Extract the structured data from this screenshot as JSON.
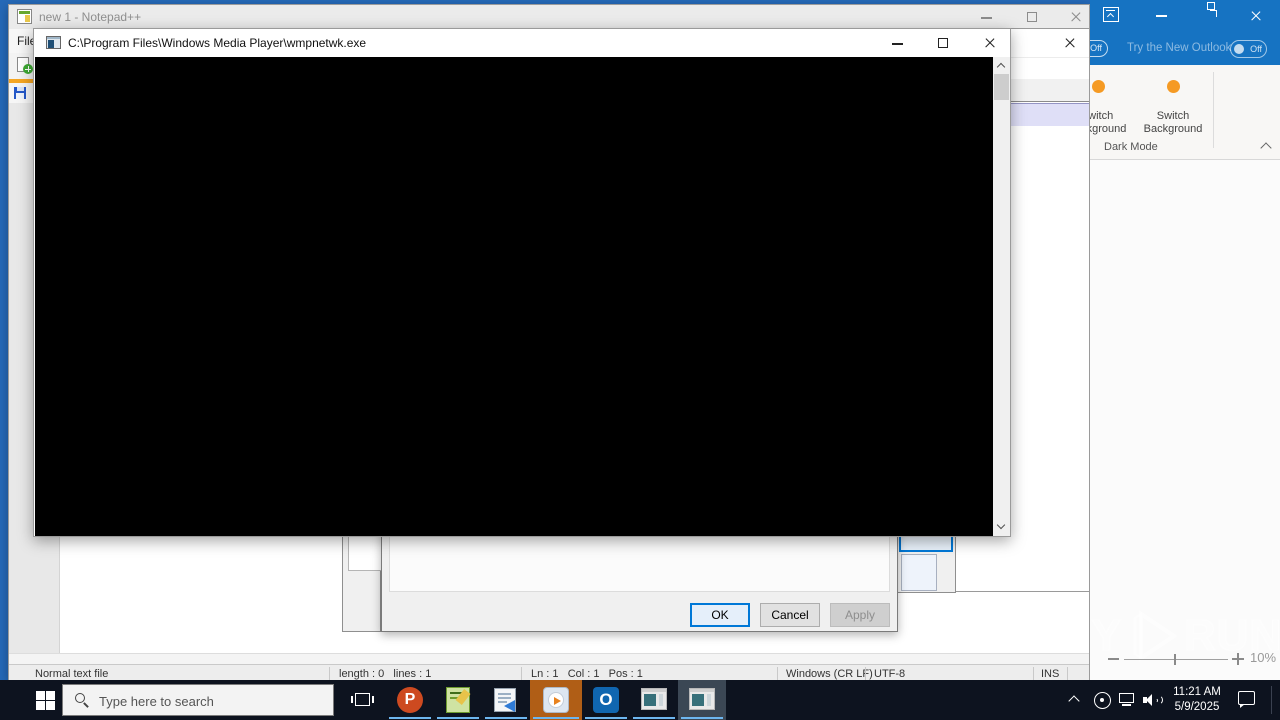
{
  "notepad": {
    "title": "new 1 - Notepad++",
    "menu": {
      "file": "File"
    },
    "statusbar": {
      "doc_type": "Normal text file",
      "length_info": "length : 0   lines : 1",
      "cursor_info": "Ln : 1   Col : 1   Pos : 1",
      "eol_format": "Windows (CR LF)",
      "encoding": "UTF-8",
      "typing_mode": "INS"
    }
  },
  "console": {
    "title": "C:\\Program Files\\Windows Media Player\\wmpnetwk.exe"
  },
  "dialog": {
    "ok_label": "OK",
    "cancel_label": "Cancel",
    "apply_label": "Apply"
  },
  "outlook": {
    "try_new_label": "Try the New Outlook",
    "toggle_state": "Off",
    "partial_toggle_state": "Off",
    "switch_background_1": "Switch Background",
    "switch_background_2": "Switch Background",
    "group_label": "Dark Mode"
  },
  "taskbar": {
    "search_placeholder": "Type here to search",
    "clock_time": "11:21 AM",
    "clock_date": "5/9/2025",
    "app_glyphs": {
      "powerpoint": "P",
      "outlook": "O"
    }
  },
  "overlay": {
    "brand_left": "ANY",
    "brand_right": "RUN",
    "zoom_level": "10%"
  },
  "colors": {
    "accent_blue": "#0078d7",
    "outlook_blue": "#1673c2",
    "attention_orange": "#b05e16",
    "desktop_blue": "#2569b8",
    "taskbar_dark": "#0d131f"
  }
}
